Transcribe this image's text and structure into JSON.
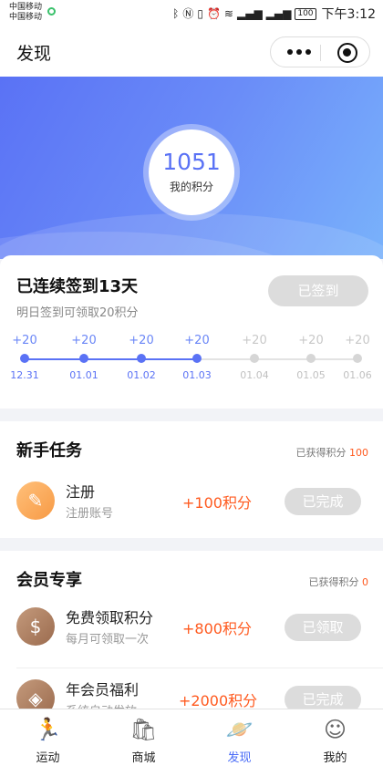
{
  "status_bar": {
    "carrier_1": "中国移动",
    "carrier_2": "中国移动",
    "battery": "100",
    "time": "下午3:12"
  },
  "header": {
    "title": "发现",
    "more_icon": "more-dots-icon",
    "close_icon": "target-circle-icon"
  },
  "points": {
    "value": "1051",
    "label": "我的积分"
  },
  "signin": {
    "title": "已连续签到13天",
    "subtitle": "明日签到可领取20积分",
    "button": "已签到",
    "days": [
      {
        "points": "+20",
        "date": "12.31",
        "done": true
      },
      {
        "points": "+20",
        "date": "01.01",
        "done": true
      },
      {
        "points": "+20",
        "date": "01.02",
        "done": true
      },
      {
        "points": "+20",
        "date": "01.03",
        "done": true
      },
      {
        "points": "+20",
        "date": "01.04",
        "done": false
      },
      {
        "points": "+20",
        "date": "01.05",
        "done": false
      },
      {
        "points": "+20",
        "date": "01.06",
        "done": false
      }
    ]
  },
  "newbie": {
    "title": "新手任务",
    "earned_label": "已获得积分",
    "earned_value": "100",
    "tasks": [
      {
        "icon": "pencil-icon",
        "name": "注册",
        "desc": "注册账号",
        "reward": "+100积分",
        "button": "已完成"
      }
    ]
  },
  "member": {
    "title": "会员专享",
    "earned_label": "已获得积分",
    "earned_value": "0",
    "tasks": [
      {
        "icon": "money-bag-icon",
        "name": "免费领取积分",
        "desc": "每月可领取一次",
        "reward": "+800积分",
        "button": "已领取"
      },
      {
        "icon": "dollar-badge-icon",
        "name": "年会员福利",
        "desc": "系统自动发放",
        "reward": "+2000积分",
        "button": "已完成"
      }
    ]
  },
  "tabs": [
    {
      "icon": "running-icon",
      "label": "运动",
      "active": false
    },
    {
      "icon": "shopping-bag-icon",
      "label": "商城",
      "active": false
    },
    {
      "icon": "planet-icon",
      "label": "发现",
      "active": true
    },
    {
      "icon": "user-face-icon",
      "label": "我的",
      "active": false
    }
  ],
  "colors": {
    "accent": "#5a72f5",
    "reward": "#ff5a1f",
    "inactive": "#cccccc"
  }
}
